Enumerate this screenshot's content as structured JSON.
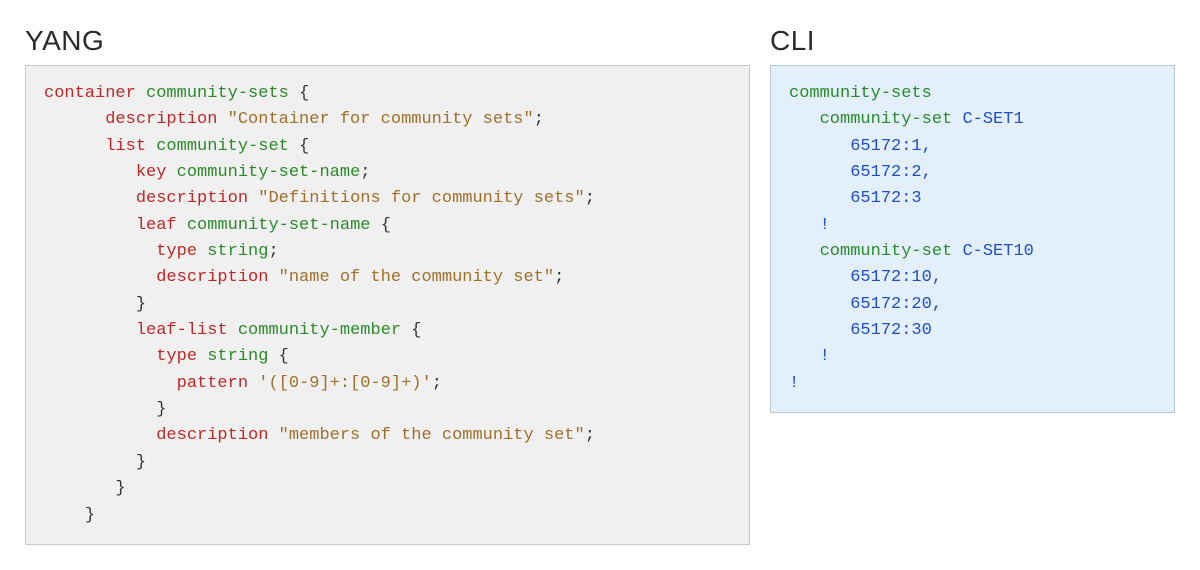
{
  "yang": {
    "title": "YANG",
    "tokens": {
      "container": "container",
      "community_sets": "community-sets",
      "lbrace": "{",
      "rbrace": "}",
      "description": "description",
      "str_container_for_community_sets": "\"Container for community sets\"",
      "semi": ";",
      "list": "list",
      "community_set": "community-set",
      "key": "key",
      "community_set_name": "community-set-name",
      "str_definitions_for_community_sets": "\"Definitions for community sets\"",
      "leaf": "leaf",
      "type": "type",
      "string": "string",
      "str_name_of_the_community_set": "\"name of the community set\"",
      "leaf_list": "leaf-list",
      "community_member": "community-member",
      "pattern": "pattern",
      "pattern_val": "'([0-9]+:[0-9]+)'",
      "str_members_of_the_community_set": "\"members of the community set\""
    }
  },
  "cli": {
    "title": "CLI",
    "tokens": {
      "community_sets": "community-sets",
      "community_set": "community-set",
      "cset1": "C-SET1",
      "cset10": "C-SET10",
      "v1": "65172:1",
      "v2": "65172:2",
      "v3": "65172:3",
      "v10": "65172:10",
      "v20": "65172:20",
      "v30": "65172:30",
      "comma": ",",
      "bang": "!"
    }
  }
}
